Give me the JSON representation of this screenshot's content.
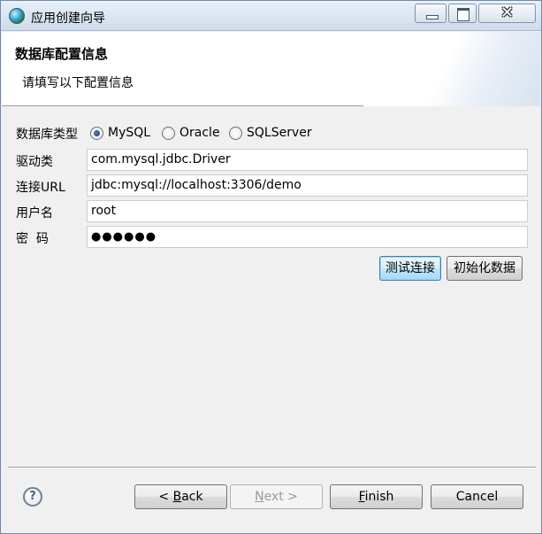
{
  "window": {
    "title": "应用创建向导",
    "close_glyph": "✕"
  },
  "banner": {
    "title": "数据库配置信息",
    "description": "请填写以下配置信息"
  },
  "form": {
    "db_type_label": "数据库类型",
    "db_types": [
      "MySQL",
      "Oracle",
      "SQLServer"
    ],
    "selected_db_type": "MySQL",
    "driver_label": "驱动类",
    "driver_value": "com.mysql.jdbc.Driver",
    "url_label": "连接URL",
    "url_value": "jdbc:mysql://localhost:3306/demo",
    "username_label": "用户名",
    "username_value": "root",
    "password_label": "密  码",
    "password_value": "●●●●●●"
  },
  "actions": {
    "test_connection": "测试连接",
    "init_data": "初始化数据"
  },
  "footer": {
    "help_glyph": "?",
    "back_prefix": "< ",
    "back_mnemonic": "B",
    "back_rest": "ack",
    "next_mnemonic": "N",
    "next_rest": "ext >",
    "finish_mnemonic": "F",
    "finish_rest": "inish",
    "cancel": "Cancel"
  },
  "colors": {
    "titlebar_top": "#e8f0f9",
    "titlebar_bottom": "#cfdceb",
    "focus_border": "#3c7fb1",
    "window_bg": "#f0f0f0"
  }
}
